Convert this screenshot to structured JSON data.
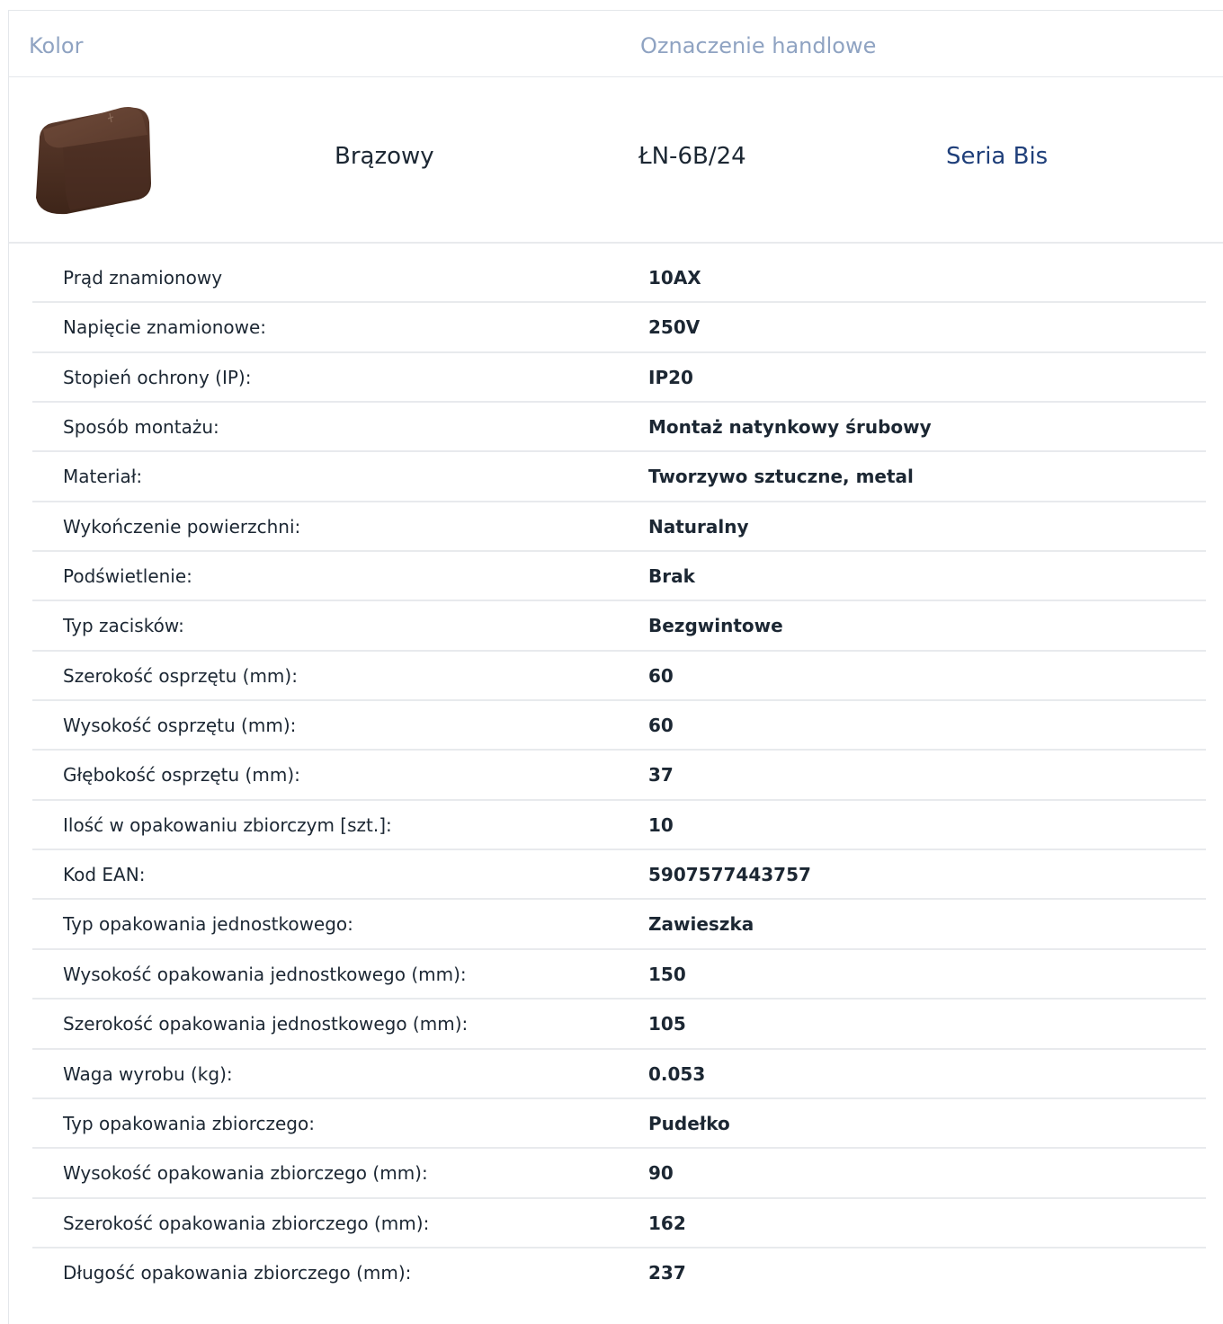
{
  "header": {
    "color_label": "Kolor",
    "trade_label": "Oznaczenie handlowe"
  },
  "product": {
    "color_name": "Brązowy",
    "code": "ŁN-6B/24",
    "series_link": "Seria Bis",
    "swatch_color": "#5a3a2c",
    "thumb_icon": "surface-socket-icon"
  },
  "specs": [
    {
      "label": "Prąd znamionowy",
      "value": "10AX"
    },
    {
      "label": "Napięcie znamionowe:",
      "value": "250V"
    },
    {
      "label": "Stopień ochrony (IP):",
      "value": "IP20"
    },
    {
      "label": "Sposób montażu:",
      "value": "Montaż natynkowy śrubowy"
    },
    {
      "label": "Materiał:",
      "value": "Tworzywo sztuczne, metal"
    },
    {
      "label": "Wykończenie powierzchni:",
      "value": "Naturalny"
    },
    {
      "label": "Podświetlenie:",
      "value": "Brak"
    },
    {
      "label": "Typ zacisków:",
      "value": "Bezgwintowe"
    },
    {
      "label": "Szerokość osprzętu (mm):",
      "value": "60"
    },
    {
      "label": "Wysokość osprzętu (mm):",
      "value": "60"
    },
    {
      "label": "Głębokość osprzętu (mm):",
      "value": "37"
    },
    {
      "label": "Ilość w opakowaniu zbiorczym [szt.]:",
      "value": "10"
    },
    {
      "label": "Kod EAN:",
      "value": "5907577443757"
    },
    {
      "label": "Typ opakowania jednostkowego:",
      "value": "Zawieszka"
    },
    {
      "label": "Wysokość opakowania jednostkowego (mm):",
      "value": "150"
    },
    {
      "label": "Szerokość opakowania jednostkowego (mm):",
      "value": "105"
    },
    {
      "label": "Waga wyrobu (kg):",
      "value": "0.053"
    },
    {
      "label": "Typ opakowania zbiorczego:",
      "value": "Pudełko"
    },
    {
      "label": "Wysokość opakowania zbiorczego (mm):",
      "value": "90"
    },
    {
      "label": "Szerokość opakowania zbiorczego (mm):",
      "value": "162"
    },
    {
      "label": "Długość opakowania zbiorczego (mm):",
      "value": "237"
    }
  ]
}
